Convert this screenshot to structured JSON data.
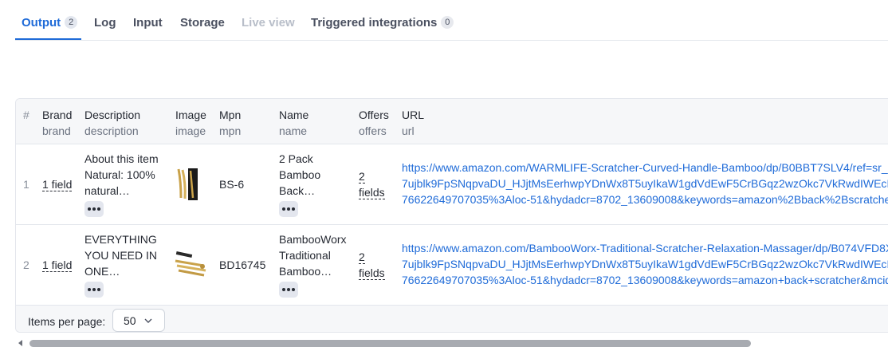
{
  "tabs": [
    {
      "label": "Output",
      "count": "2",
      "active": true
    },
    {
      "label": "Log"
    },
    {
      "label": "Input"
    },
    {
      "label": "Storage"
    },
    {
      "label": "Live view",
      "disabled": true
    },
    {
      "label": "Triggered integrations",
      "count": "0"
    }
  ],
  "table": {
    "columns": [
      {
        "label": "#",
        "sub": ""
      },
      {
        "label": "Brand",
        "sub": "brand"
      },
      {
        "label": "Description",
        "sub": "description"
      },
      {
        "label": "Image",
        "sub": "image"
      },
      {
        "label": "Mpn",
        "sub": "mpn"
      },
      {
        "label": "Name",
        "sub": "name"
      },
      {
        "label": "Offers",
        "sub": "offers"
      },
      {
        "label": "URL",
        "sub": "url"
      }
    ],
    "rows": [
      {
        "index": "1",
        "brand": "1 field",
        "description": [
          "About this item",
          "Natural: 100%",
          "natural…"
        ],
        "mpn": "BS-6",
        "name": [
          "2 Pack",
          "Bamboo",
          "Back…"
        ],
        "offers": [
          "2",
          "fields"
        ],
        "url": [
          "https://www.amazon.com/WARMLIFE-Scratcher-Curved-Handle-Bamboo/dp/B0BBT7SLV4/ref=sr_",
          "7ujblk9FpSNqpvaDU_HJjtMsEerhwpYDnWx8T5uyIkaW1gdVdEwF5CrBGqz2wzOkc7VkRwdIWEcI",
          "76622649707035%3Aloc-51&hydadcr=8702_13609008&keywords=amazon%2Bback%2Bscratche"
        ]
      },
      {
        "index": "2",
        "brand": "1 field",
        "description": [
          "EVERYTHING",
          "YOU NEED IN",
          "ONE…"
        ],
        "mpn": "BD16745",
        "name": [
          "BambooWorx",
          "Traditional",
          "Bamboo…"
        ],
        "offers": [
          "2",
          "fields"
        ],
        "url": [
          "https://www.amazon.com/BambooWorx-Traditional-Scratcher-Relaxation-Massager/dp/B074VFD8X",
          "7ujblk9FpSNqpvaDU_HJjtMsEerhwpYDnWx8T5uyIkaW1gdVdEwF5CrBGqz2wzOkc7VkRwdIWEcI",
          "76622649707035%3Aloc-51&hydadcr=8702_13609008&keywords=amazon+back+scratcher&mcid"
        ]
      }
    ]
  },
  "footer": {
    "items_per_page_label": "Items per page:",
    "items_per_page_value": "50"
  },
  "colors": {
    "accent": "#1f6bd8",
    "link": "#1f6bd8",
    "border": "#e3e6ec"
  }
}
